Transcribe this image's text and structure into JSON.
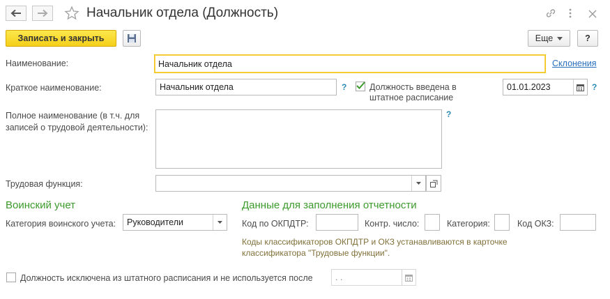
{
  "window": {
    "title": "Начальник отдела (Должность)"
  },
  "toolbar": {
    "save_close_label": "Записать и закрыть",
    "more_label": "Еще",
    "help_label": "?"
  },
  "form": {
    "name_label": "Наименование:",
    "name_value": "Начальник отдела",
    "declensions_link": "Склонения",
    "short_name_label": "Краткое наименование:",
    "short_name_value": "Начальник отдела",
    "short_name_help": "?",
    "staff_checkbox_label_line1": "Должность введена в",
    "staff_checkbox_label_line2": "штатное расписание",
    "staff_checked": true,
    "staff_date_value": "01.01.2023",
    "staff_date_help": "?",
    "full_name_label_line1": "Полное наименование (в т.ч. для",
    "full_name_label_line2": "записей о трудовой деятельности):",
    "full_name_value": "",
    "full_name_help": "?",
    "labor_function_label": "Трудовая функция:",
    "labor_function_value": ""
  },
  "military": {
    "section_title": "Воинский учет",
    "category_label": "Категория воинского учета:",
    "category_value": "Руководители"
  },
  "reporting": {
    "section_title": "Данные для заполнения отчетности",
    "okpdtr_label": "Код по ОКПДТР:",
    "okpdtr_value": "",
    "control_label": "Контр. число:",
    "control_value": "",
    "category_label": "Категория:",
    "category_value": "",
    "okz_label": "Код ОКЗ:",
    "okz_value": "",
    "note_line1": "Коды классификаторов ОКПДТР и ОКЗ устанавливаются в карточке",
    "note_line2": "классификатора \"Трудовые функции\"."
  },
  "excluded": {
    "checkbox_label": "Должность исключена из штатного расписания и не используется после",
    "checked": false,
    "date_value": " .  ."
  },
  "colors": {
    "accent_yellow": "#f5cf1a",
    "section_green": "#3c9a2c",
    "help_blue": "#2a8bb3",
    "link_blue": "#2a6ebd",
    "note_text": "#80703a"
  }
}
